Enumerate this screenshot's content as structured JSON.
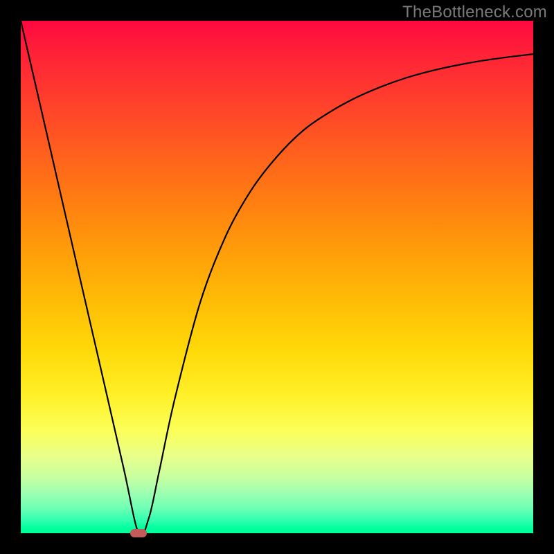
{
  "watermark": "TheBottleneck.com",
  "chart_data": {
    "type": "line",
    "title": "",
    "xlabel": "",
    "ylabel": "",
    "xlim": [
      0,
      100
    ],
    "ylim": [
      0,
      100
    ],
    "grid": false,
    "legend": false,
    "series": [
      {
        "name": "curve",
        "x": [
          0,
          5,
          10,
          15,
          20,
          23,
          25,
          27,
          30,
          35,
          40,
          45,
          50,
          55,
          60,
          65,
          70,
          75,
          80,
          85,
          90,
          95,
          100
        ],
        "y": [
          100,
          78.3,
          56.5,
          34.8,
          13.0,
          0,
          3,
          12,
          26,
          45,
          58,
          67,
          73.5,
          78.5,
          82,
          84.8,
          87,
          88.8,
          90.2,
          91.3,
          92.2,
          92.9,
          93.5
        ]
      }
    ],
    "marker": {
      "x": 23,
      "y": 0,
      "color": "#c45a5a"
    },
    "background_gradient": {
      "type": "vertical",
      "stops": [
        {
          "pos": 0.0,
          "color": "#ff0840"
        },
        {
          "pos": 0.5,
          "color": "#ffc400"
        },
        {
          "pos": 0.8,
          "color": "#fdff50"
        },
        {
          "pos": 1.0,
          "color": "#00ff96"
        }
      ]
    }
  }
}
